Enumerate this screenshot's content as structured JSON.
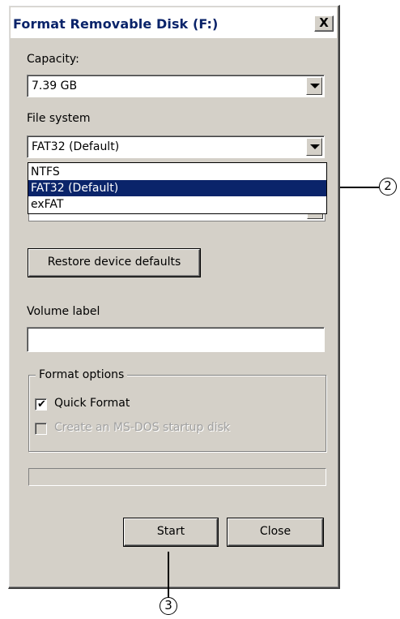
{
  "window": {
    "title": "Format Removable Disk (F:)",
    "close_label": "X"
  },
  "capacity": {
    "label": "Capacity:",
    "value": "7.39 GB"
  },
  "file_system": {
    "label": "File system",
    "value": "FAT32 (Default)",
    "options": [
      "NTFS",
      "FAT32 (Default)",
      "exFAT"
    ],
    "selected_index": 1
  },
  "restore_button": {
    "label": "Restore device defaults"
  },
  "volume_label": {
    "label": "Volume label",
    "value": ""
  },
  "format_options": {
    "legend": "Format options",
    "quick_format": {
      "label": "Quick Format",
      "checked": true,
      "enabled": true
    },
    "msdos_startup": {
      "label": "Create an MS-DOS startup disk",
      "checked": false,
      "enabled": false
    }
  },
  "progress": {
    "value_percent": 0
  },
  "buttons": {
    "start": "Start",
    "close": "Close"
  },
  "callouts": {
    "dropdown_marker": "2",
    "start_marker": "3"
  }
}
